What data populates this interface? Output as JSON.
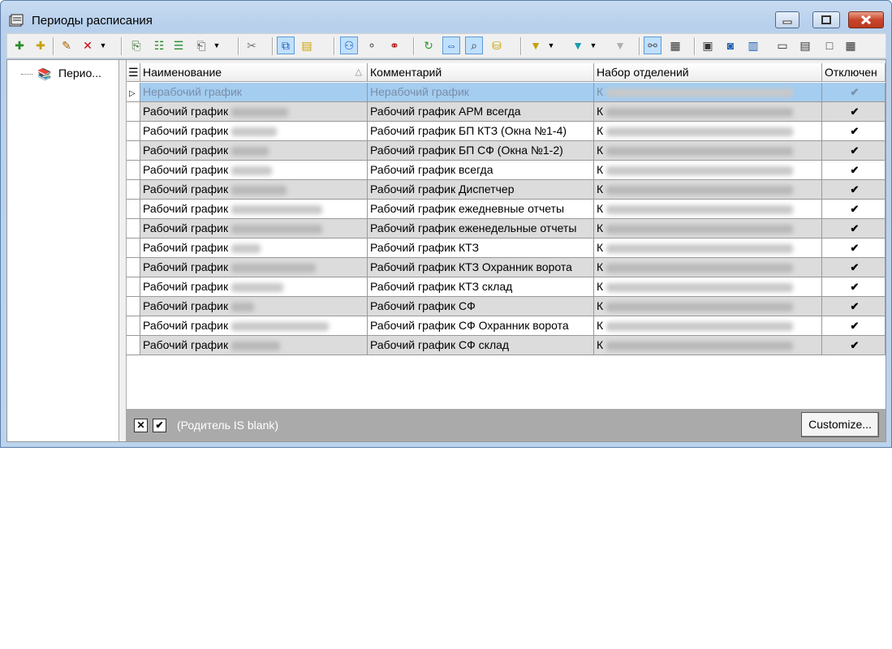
{
  "window": {
    "title": "Периоды расписания"
  },
  "toolbar": {
    "buttons": [
      {
        "name": "add-root-icon",
        "glyph": "✚",
        "color": "#2a8a2a"
      },
      {
        "name": "add-child-icon",
        "glyph": "✚",
        "color": "#c8a000"
      },
      {
        "name": "edit-icon",
        "glyph": "✎",
        "color": "#b06000"
      },
      {
        "name": "delete-icon",
        "glyph": "✕",
        "color": "#d00000"
      },
      {
        "name": "copy-icon",
        "glyph": "⎘",
        "color": "#2a6a2a"
      },
      {
        "name": "tree-icon",
        "glyph": "☷",
        "color": "#2a8a2a"
      },
      {
        "name": "tree-expand-icon",
        "glyph": "☰",
        "color": "#2a8a2a"
      },
      {
        "name": "paste-icon",
        "glyph": "⎗",
        "color": "#555"
      },
      {
        "name": "cut-icon",
        "glyph": "✂",
        "color": "#777"
      },
      {
        "name": "layout-icon",
        "glyph": "⧉",
        "color": "#1a5ab0"
      },
      {
        "name": "folder-icon",
        "glyph": "▤",
        "color": "#c8a000"
      },
      {
        "name": "hierarchy-icon",
        "glyph": "⚇",
        "color": "#1a5ab0"
      },
      {
        "name": "nodes-icon",
        "glyph": "⚬",
        "color": "#555"
      },
      {
        "name": "link-icon",
        "glyph": "⚭",
        "color": "#b00000"
      },
      {
        "name": "refresh-icon",
        "glyph": "↻",
        "color": "#2a9a2a"
      },
      {
        "name": "move-icon",
        "glyph": "⇔",
        "color": "#1a5ab0"
      },
      {
        "name": "search-icon",
        "glyph": "⌕",
        "color": "#333"
      },
      {
        "name": "database-icon",
        "glyph": "⛁",
        "color": "#c8a000"
      },
      {
        "name": "filter-icon",
        "glyph": "▼",
        "color": "#c8a000"
      },
      {
        "name": "filter-active-icon",
        "glyph": "▼",
        "color": "#1a9ab0"
      },
      {
        "name": "funnel-disabled-icon",
        "glyph": "▼",
        "color": "#b0b0b0"
      },
      {
        "name": "group-icon",
        "glyph": "⚯",
        "color": "#555"
      },
      {
        "name": "grid-icon",
        "glyph": "▦",
        "color": "#333"
      },
      {
        "name": "form-icon",
        "glyph": "▣",
        "color": "#333"
      },
      {
        "name": "card-icon",
        "glyph": "◙",
        "color": "#1a5ab0"
      },
      {
        "name": "columns-icon",
        "glyph": "▥",
        "color": "#1a5ab0"
      },
      {
        "name": "field-icon",
        "glyph": "▭",
        "color": "#333"
      },
      {
        "name": "split-h-icon",
        "glyph": "▤",
        "color": "#333"
      },
      {
        "name": "panel-icon",
        "glyph": "□",
        "color": "#333"
      },
      {
        "name": "table-icon",
        "glyph": "▦",
        "color": "#333"
      }
    ]
  },
  "tree": {
    "root_label": "Перио..."
  },
  "grid": {
    "columns": [
      "Наименование",
      "Комментарий",
      "Набор отделений",
      "Отключен"
    ],
    "rows": [
      {
        "name": "Нерабочий график",
        "comment": "Нерабочий график",
        "dept": "К",
        "disabled": "✔"
      },
      {
        "name": "Рабочий график",
        "comment": "Рабочий график АРМ всегда",
        "dept": "К",
        "disabled": "✔"
      },
      {
        "name": "Рабочий график",
        "comment": "Рабочий график БП КТЗ (Окна №1-4)",
        "dept": "К",
        "disabled": "✔"
      },
      {
        "name": "Рабочий график",
        "comment": "Рабочий график БП СФ (Окна №1-2)",
        "dept": "К",
        "disabled": "✔"
      },
      {
        "name": "Рабочий график",
        "comment": "Рабочий график всегда",
        "dept": "К",
        "disabled": "✔"
      },
      {
        "name": "Рабочий график",
        "comment": "Рабочий график Диспетчер",
        "dept": "К",
        "disabled": "✔"
      },
      {
        "name": "Рабочий график",
        "comment": "Рабочий график ежедневные отчеты",
        "dept": "К",
        "disabled": "✔"
      },
      {
        "name": "Рабочий график",
        "comment": "Рабочий график еженедельные отчеты",
        "dept": "К",
        "disabled": "✔"
      },
      {
        "name": "Рабочий график",
        "comment": "Рабочий график КТЗ",
        "dept": "К",
        "disabled": "✔"
      },
      {
        "name": "Рабочий график",
        "comment": "Рабочий график КТЗ Охранник ворота",
        "dept": "К",
        "disabled": "✔"
      },
      {
        "name": "Рабочий график",
        "comment": "Рабочий график КТЗ склад",
        "dept": "К",
        "disabled": "✔"
      },
      {
        "name": "Рабочий график",
        "comment": "Рабочий график СФ",
        "dept": "К",
        "disabled": "✔"
      },
      {
        "name": "Рабочий график",
        "comment": "Рабочий график СФ Охранник ворота",
        "dept": "К",
        "disabled": "✔"
      },
      {
        "name": "Рабочий график",
        "comment": "Рабочий график СФ склад",
        "dept": "К",
        "disabled": "✔"
      }
    ]
  },
  "filter": {
    "text": "(Родитель IS blank)",
    "close_glyph": "✕",
    "check_glyph": "✔",
    "customize_label": "Customize..."
  }
}
